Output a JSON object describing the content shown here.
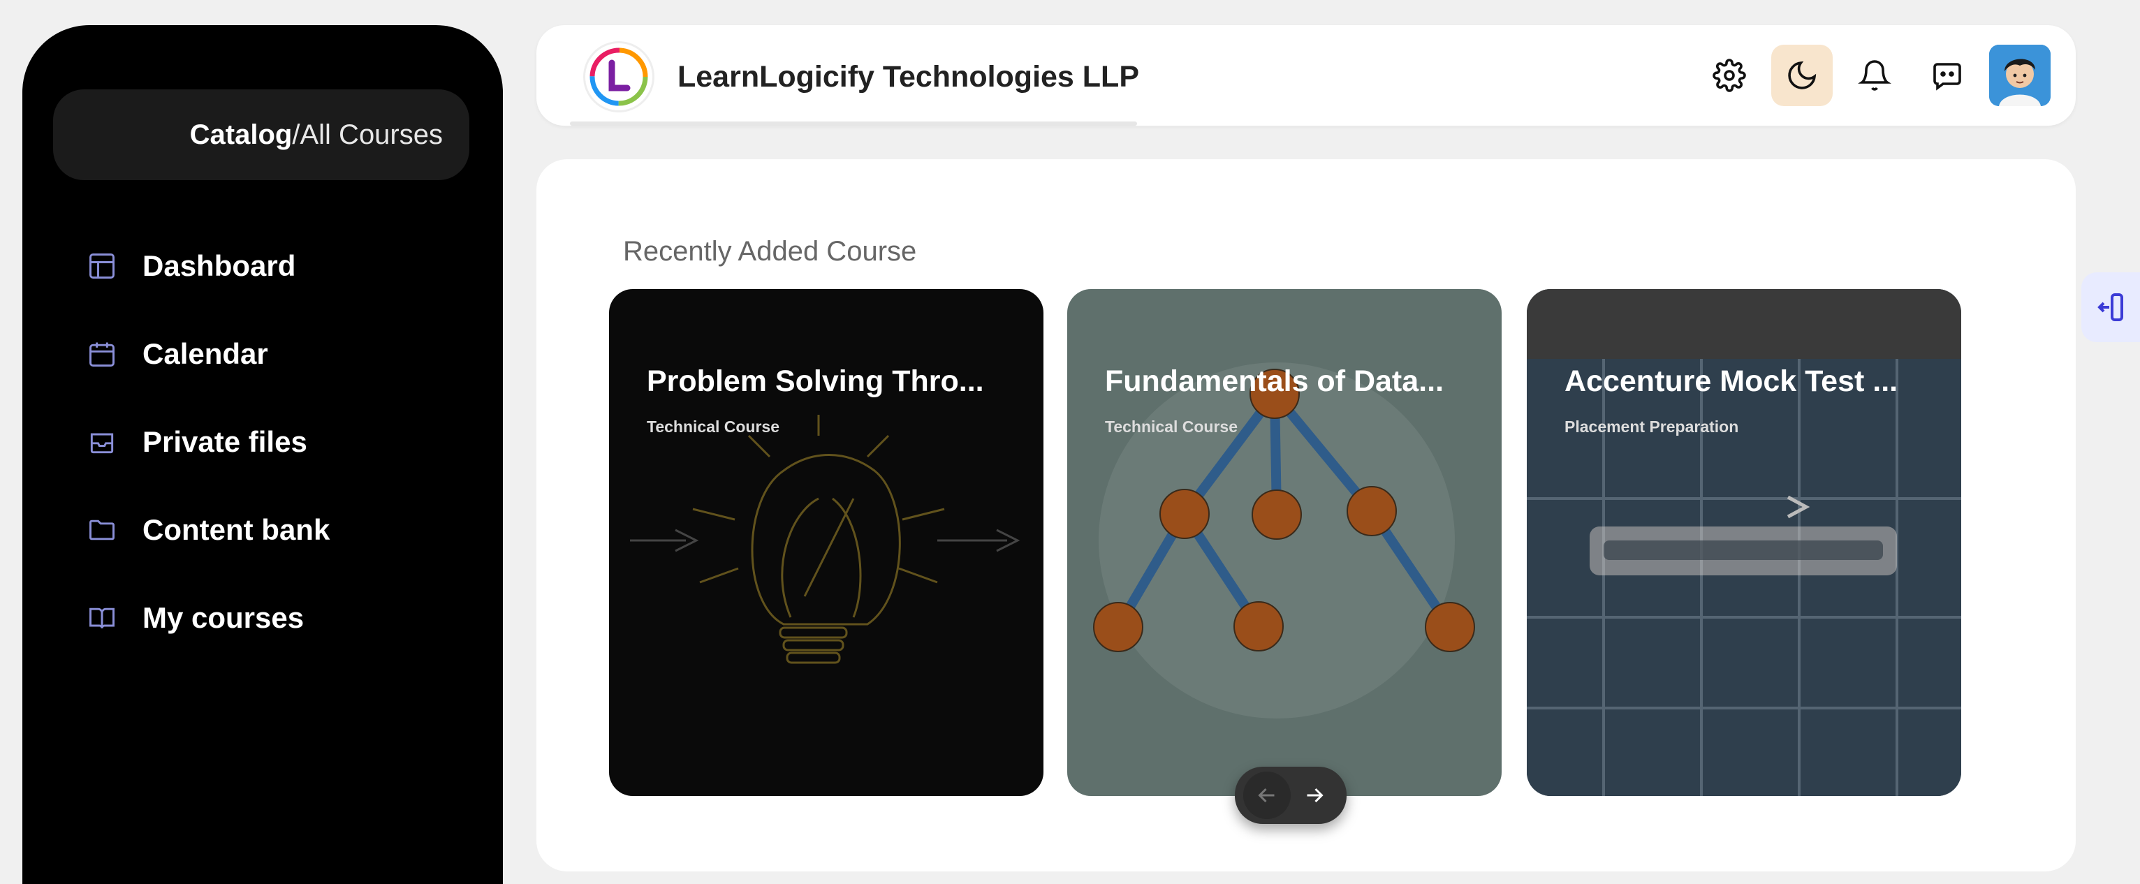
{
  "sidebar": {
    "breadcrumb": {
      "section": "Catalog",
      "separator": "/",
      "page": "All Courses"
    },
    "items": [
      {
        "label": "Dashboard",
        "icon": "layout-icon"
      },
      {
        "label": "Calendar",
        "icon": "calendar-icon"
      },
      {
        "label": "Private files",
        "icon": "inbox-icon"
      },
      {
        "label": "Content bank",
        "icon": "folder-icon"
      },
      {
        "label": "My courses",
        "icon": "book-icon"
      }
    ]
  },
  "header": {
    "brand": "LearnLogicify Technologies LLP",
    "icons": [
      "gear-icon",
      "moon-icon",
      "bell-icon",
      "chat-icon",
      "avatar"
    ],
    "accent": "#f8e5cd"
  },
  "main": {
    "section_title": "Recently Added Course",
    "courses": [
      {
        "title": "Problem Solving Thro...",
        "category": "Technical Course"
      },
      {
        "title": "Fundamentals of Data...",
        "category": "Technical Course"
      },
      {
        "title": "Accenture Mock Test ...",
        "category": "Placement Preparation"
      }
    ],
    "pager": {
      "prev_icon": "arrow-left-icon",
      "next_icon": "arrow-right-icon"
    }
  },
  "colors": {
    "sidebar": "#000000",
    "panel": "#ffffff",
    "side_tab": "#3b3bd6"
  }
}
